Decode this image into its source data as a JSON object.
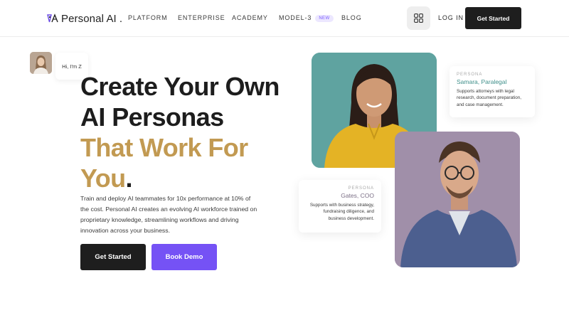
{
  "header": {
    "logo_text": "Personal AI",
    "logo_dot": ".",
    "nav": [
      {
        "label": "PLATFORM"
      },
      {
        "label": "ENTERPRISE"
      },
      {
        "label": "ACADEMY"
      },
      {
        "label": "MODEL-3",
        "badge": "NEW"
      },
      {
        "label": "BLOG"
      }
    ],
    "login_label": "LOG IN",
    "cta_label": "Get Started"
  },
  "hero": {
    "greeting": "Hi, I'm Z",
    "headline_line1": "Create Your Own",
    "headline_line2": "AI Personas",
    "headline_gold_line1": "That Work For",
    "headline_gold_line2": "You",
    "headline_period": ".",
    "subtext": "Train and deploy AI teammates for 10x performance at 10% of the cost. Personal AI creates an evolving AI workforce trained on proprietary knowledge, streamlining workflows and driving innovation across your business.",
    "primary_button": "Get Started",
    "secondary_button": "Book Demo"
  },
  "personas": [
    {
      "tag": "PERSONA",
      "name": "Samara, Paralegal",
      "description": "Supports attorneys with legal research, document preparation, and case management."
    },
    {
      "tag": "PERSONA",
      "name": "Gates, COO",
      "description": "Supports with business strategy, fundraising diligence, and business development."
    }
  ],
  "colors": {
    "accent_purple": "#7552f5",
    "gold": "#c29a52",
    "dark": "#1e1e1e",
    "teal_bg": "#5fa3a0",
    "mauve_bg": "#a08fa9"
  },
  "icons": {
    "logo": "personal-ai-logo-icon",
    "grid": "grid-icon"
  }
}
